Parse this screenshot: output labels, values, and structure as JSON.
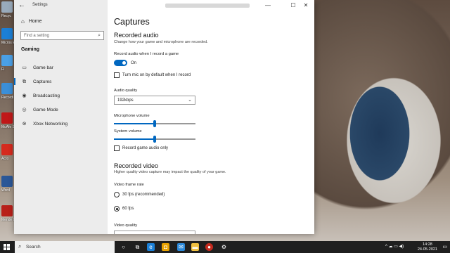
{
  "desktop": {
    "icons": [
      {
        "label": "Recyc",
        "color": "#9ab"
      },
      {
        "label": "Micros Edge",
        "color": "#1b7fd6"
      },
      {
        "label": "Fi",
        "color": "#4aa0e6"
      },
      {
        "label": "Recordi",
        "color": "#3b8fd8"
      },
      {
        "label": "McAfe Secu",
        "color": "#c01818"
      },
      {
        "label": "Acro",
        "color": "#d62a1e"
      },
      {
        "label": "Word",
        "color": "#2b5797"
      },
      {
        "label": "Mende Desk",
        "color": "#b8201a"
      }
    ]
  },
  "window": {
    "title": "Settings",
    "back": "←",
    "minimize": "—",
    "maximize": "☐",
    "close": "✕"
  },
  "nav": {
    "home": "Home",
    "search_placeholder": "Find a setting",
    "section": "Gaming",
    "items": [
      {
        "label": "Game bar",
        "icon": "game-bar-icon",
        "glyph": "▭"
      },
      {
        "label": "Captures",
        "icon": "captures-icon",
        "glyph": "⧉",
        "active": true
      },
      {
        "label": "Broadcasting",
        "icon": "broadcasting-icon",
        "glyph": "◉"
      },
      {
        "label": "Game Mode",
        "icon": "game-mode-icon",
        "glyph": "◎"
      },
      {
        "label": "Xbox Networking",
        "icon": "xbox-icon",
        "glyph": "⊗"
      }
    ]
  },
  "content": {
    "title": "Captures",
    "audio_section": {
      "title": "Recorded audio",
      "description": "Change how your game and microphone are recorded.",
      "record_audio_label": "Record audio when I record a game",
      "toggle_state": "On",
      "mic_checkbox": "Turn mic on by default when I record",
      "quality_label": "Audio quality",
      "quality_value": "192kbps",
      "mic_volume_label": "Microphone volume",
      "mic_volume_level": 0.5,
      "system_volume_label": "System volume",
      "system_volume_level": 0.5,
      "game_audio_only": "Record game audio only"
    },
    "video_section": {
      "title": "Recorded video",
      "description": "Higher quality video capture may impact the quality of your game.",
      "frame_rate_label": "Video frame rate",
      "options": [
        "30 fps (recommended)",
        "60 fps"
      ],
      "selected": "60 fps",
      "quality_label": "Video quality"
    }
  },
  "taskbar": {
    "search_placeholder": "Search",
    "time": "14:28",
    "date": "24-05-2021",
    "tray": "^ ☁ ▭ ◀)"
  },
  "colors": {
    "accent": "#0067c0"
  }
}
